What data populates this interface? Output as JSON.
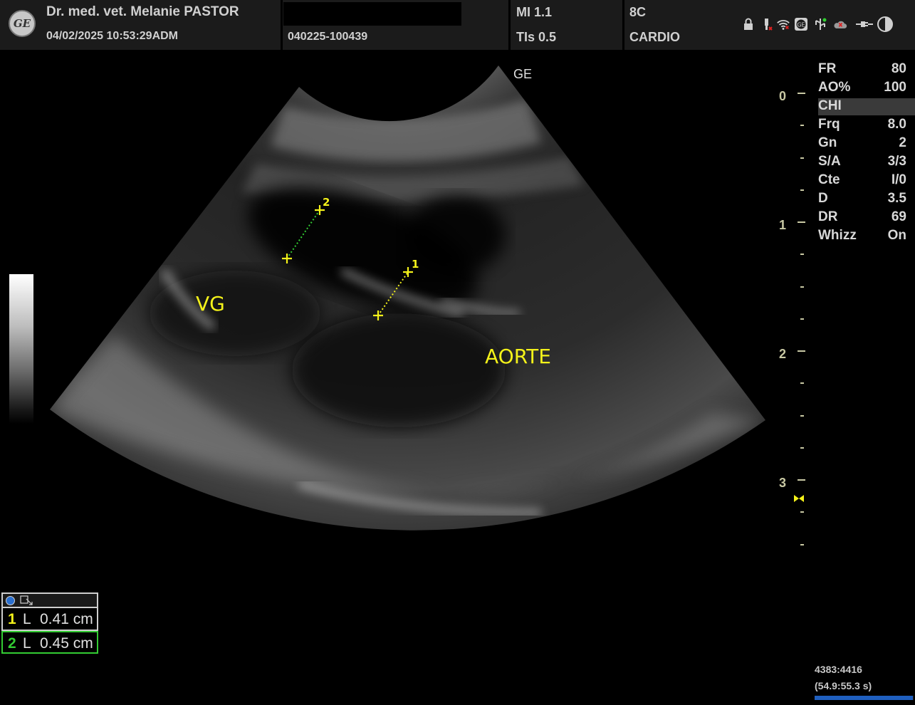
{
  "header": {
    "logo_text": "GE",
    "operator": "Dr. med. vet. Melanie PASTOR",
    "datetime": "04/02/2025 10:53:29ADM",
    "exam_id": "040225-100439",
    "mi": "MI 1.1",
    "tis": "TIs 0.5",
    "probe": "8C",
    "preset": "CARDIO"
  },
  "status_icons": [
    "lock-icon",
    "usb-power-icon",
    "wifi-icon",
    "ge-badge-icon",
    "network-icon",
    "cloud-offline-icon",
    "plug-icon",
    "contrast-icon"
  ],
  "image": {
    "orientation_marker": "GE",
    "labels": {
      "vg": "VG",
      "aorte": "AORTE"
    },
    "caliper_numbers": [
      "1",
      "2"
    ]
  },
  "params": [
    {
      "key": "FR",
      "value": "80"
    },
    {
      "key": "AO%",
      "value": "100"
    },
    {
      "key": "CHI",
      "value": ""
    },
    {
      "key": "Frq",
      "value": "8.0"
    },
    {
      "key": "Gn",
      "value": "2"
    },
    {
      "key": "S/A",
      "value": "3/3"
    },
    {
      "key": "Cte",
      "value": "I/0"
    },
    {
      "key": "D",
      "value": "3.5"
    },
    {
      "key": "DR",
      "value": "69"
    },
    {
      "key": "Whizz",
      "value": "On"
    }
  ],
  "depth_scale": [
    "0",
    "1",
    "2",
    "3"
  ],
  "measurements": [
    {
      "index": "1",
      "type": "L",
      "value": "0.41 cm",
      "color": "#f4f21a"
    },
    {
      "index": "2",
      "type": "L",
      "value": "0.45 cm",
      "color": "#33cc33"
    }
  ],
  "frame_counter": {
    "frames": "4383:4416",
    "time": "(54.9:55.3 s)"
  },
  "colors": {
    "annotation": "#f4f21a",
    "caliper2": "#33cc33",
    "depth_scale": "#c9c9a4",
    "progress": "#1f5fbf"
  },
  "cine_progress": 0.99
}
